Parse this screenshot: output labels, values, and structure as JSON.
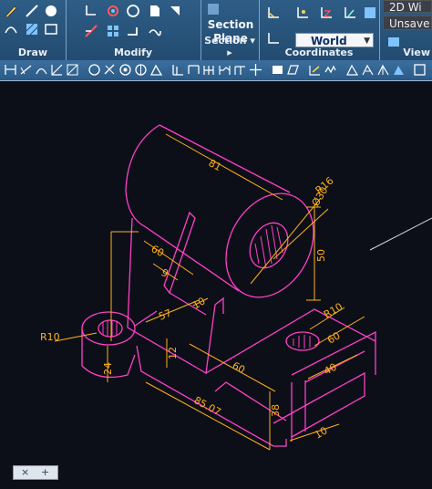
{
  "ribbon": {
    "panels": {
      "draw": "Draw",
      "modify": "Modify",
      "section": "Section",
      "coordinates": "Coordinates",
      "view": "View"
    },
    "section_plane": "Section\nPlane",
    "section_plane_line1": "Section",
    "section_plane_line2": "Plane",
    "world_combo": "World",
    "unsaved": "Unsave",
    "wireframe": "2D Wi"
  },
  "drawing": {
    "dimensions": {
      "d81": "81",
      "dia_r": "Ø30",
      "r16": "R16",
      "d50": "50",
      "d60_left": "60",
      "d9": "9",
      "d57": "57",
      "d10_mid": "10",
      "r10_left": "R10",
      "d24": "24",
      "d12": "12",
      "d60_base": "60",
      "d85": "85.07",
      "d38": "38",
      "r10_right": "R10",
      "d60_right": "60",
      "d40": "40",
      "d10_bottom": "10"
    },
    "colors": {
      "object": "#ff40c8",
      "dimension": "#ffb21a",
      "hatch": "#ff40c8",
      "background": "#0d0f18"
    }
  },
  "status": {
    "close": "×",
    "add": "+"
  }
}
